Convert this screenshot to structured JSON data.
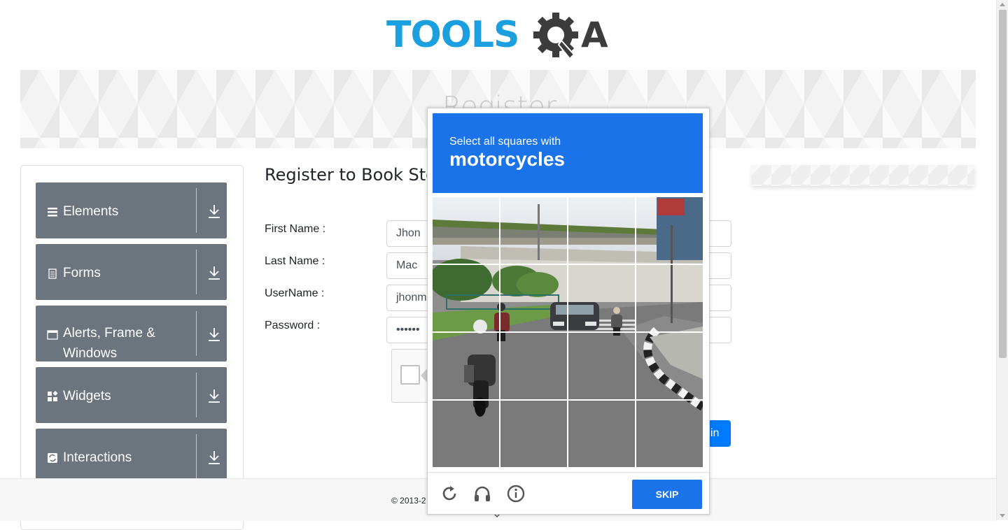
{
  "logo": {
    "text": "TOOLS",
    "suffix": "A",
    "name": "ToolsQA"
  },
  "banner": {
    "title": "Register"
  },
  "sidebar": {
    "items": [
      {
        "label": "Elements",
        "icon": "hamburger-icon"
      },
      {
        "label": "Forms",
        "icon": "document-icon"
      },
      {
        "label": "Alerts, Frame & Windows",
        "icon": "window-icon"
      },
      {
        "label": "Widgets",
        "icon": "widgets-icon"
      },
      {
        "label": "Interactions",
        "icon": "interactions-icon"
      }
    ],
    "download_icon": "download-icon"
  },
  "form": {
    "title": "Register to Book Store",
    "fields": [
      {
        "label": "First Name :",
        "value": "Jhon"
      },
      {
        "label": "Last Name :",
        "value": "Mac"
      },
      {
        "label": "UserName :",
        "value": "jhonm"
      },
      {
        "label": "Password :",
        "value": "••••••"
      }
    ],
    "login_label": "gin"
  },
  "footer": {
    "text": "© 2013-2"
  },
  "captcha": {
    "prompt": "Select all squares with",
    "object": "motorcycles",
    "skip_label": "SKIP",
    "icons": [
      "reload-icon",
      "headphones-icon",
      "info-icon"
    ],
    "header_color": "#1a73e8"
  },
  "colors": {
    "sidebar_item": "#6c757d",
    "brand": "#1b9fde",
    "login": "#007bff"
  }
}
